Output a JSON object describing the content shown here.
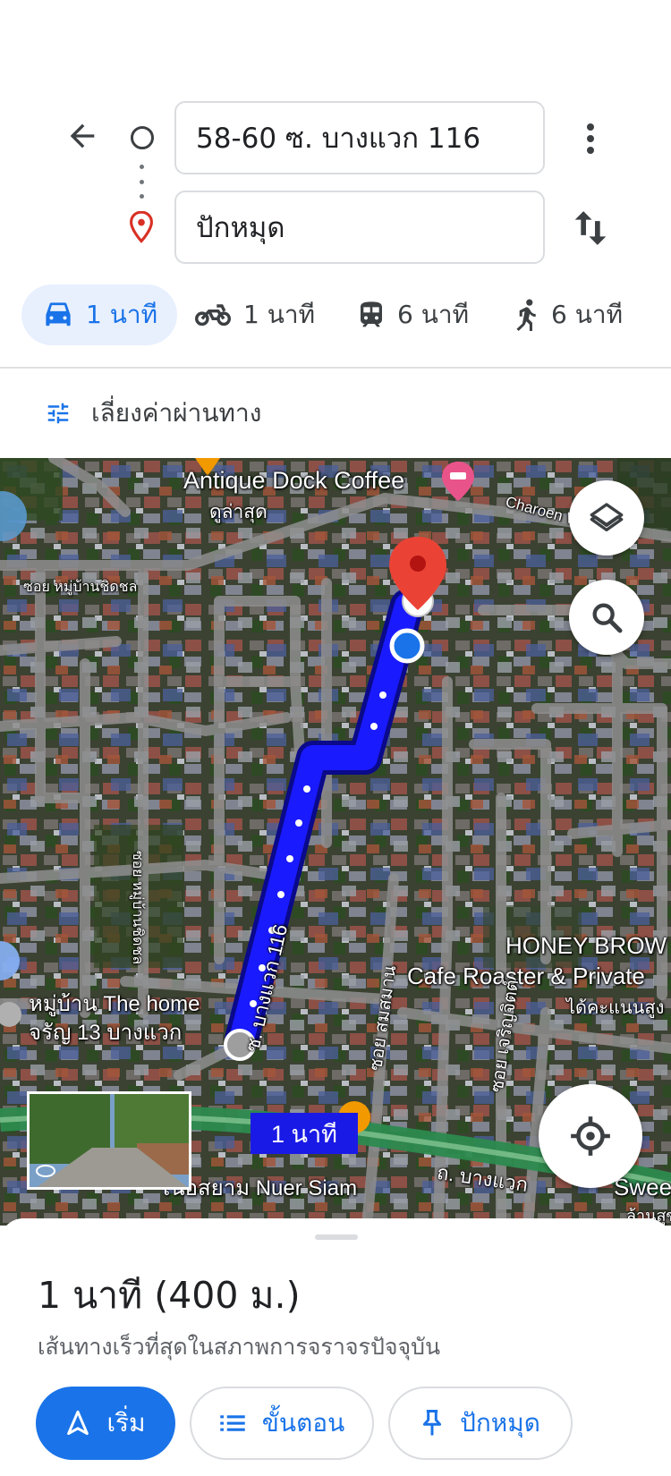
{
  "directions": {
    "origin_value": "58-60 ซ. บางแวก 116",
    "destination_value": "ปักหมุด"
  },
  "modes": [
    {
      "icon": "car-icon",
      "label": "1 นาที",
      "selected": true
    },
    {
      "icon": "motorcycle-icon",
      "label": "1 นาที",
      "selected": false
    },
    {
      "icon": "transit-icon",
      "label": "6 นาที",
      "selected": false
    },
    {
      "icon": "walk-icon",
      "label": "6 นาที",
      "selected": false
    }
  ],
  "options": {
    "avoid_tolls_label": "เลี่ยงค่าผ่านทาง"
  },
  "map": {
    "labels": {
      "antique": "Antique Dock Coffee",
      "antique_sub": "ดูล่าสุด",
      "charoen": "Charoen W",
      "soi_chitchon_h": "ซอย หมู่บ้านชิดชล",
      "soi_chitchon_v": "ซอย หมู่บ้านชิดชล",
      "honey1": "HONEY BROW",
      "honey2": "Cafe Roaster & Private",
      "honey3": "ได้คะแนนสูง",
      "bangwaek116": "ซ. บางแวก 116",
      "somsamarn": "ซอย สมสมาน",
      "charoenjit": "ซอย เจริญจิตต์",
      "thehome1": "หมู่บ้าน The home",
      "thehome2": "จรัญ 13 บางแวก",
      "nuersiam": "เนื้อสยาม Nuer Siam",
      "road_bangwaek": "ถ. บางแวก",
      "sweet1": "Swee",
      "sweet2": "ล้านสุข"
    },
    "route_eta": "1 นาที",
    "route_color": "#1a1aff",
    "destination_pin_color": "#ea4335"
  },
  "summary": {
    "title": "1 นาที (400 ม.)",
    "subtitle": "เส้นทางเร็วที่สุดในสภาพการจราจรปัจจุบัน"
  },
  "actions": {
    "start_label": "เริ่ม",
    "steps_label": "ขั้นตอน",
    "pin_label": "ปักหมุด"
  },
  "colors": {
    "accent": "#1a73e8",
    "chip_bg": "#e8f0fe"
  }
}
